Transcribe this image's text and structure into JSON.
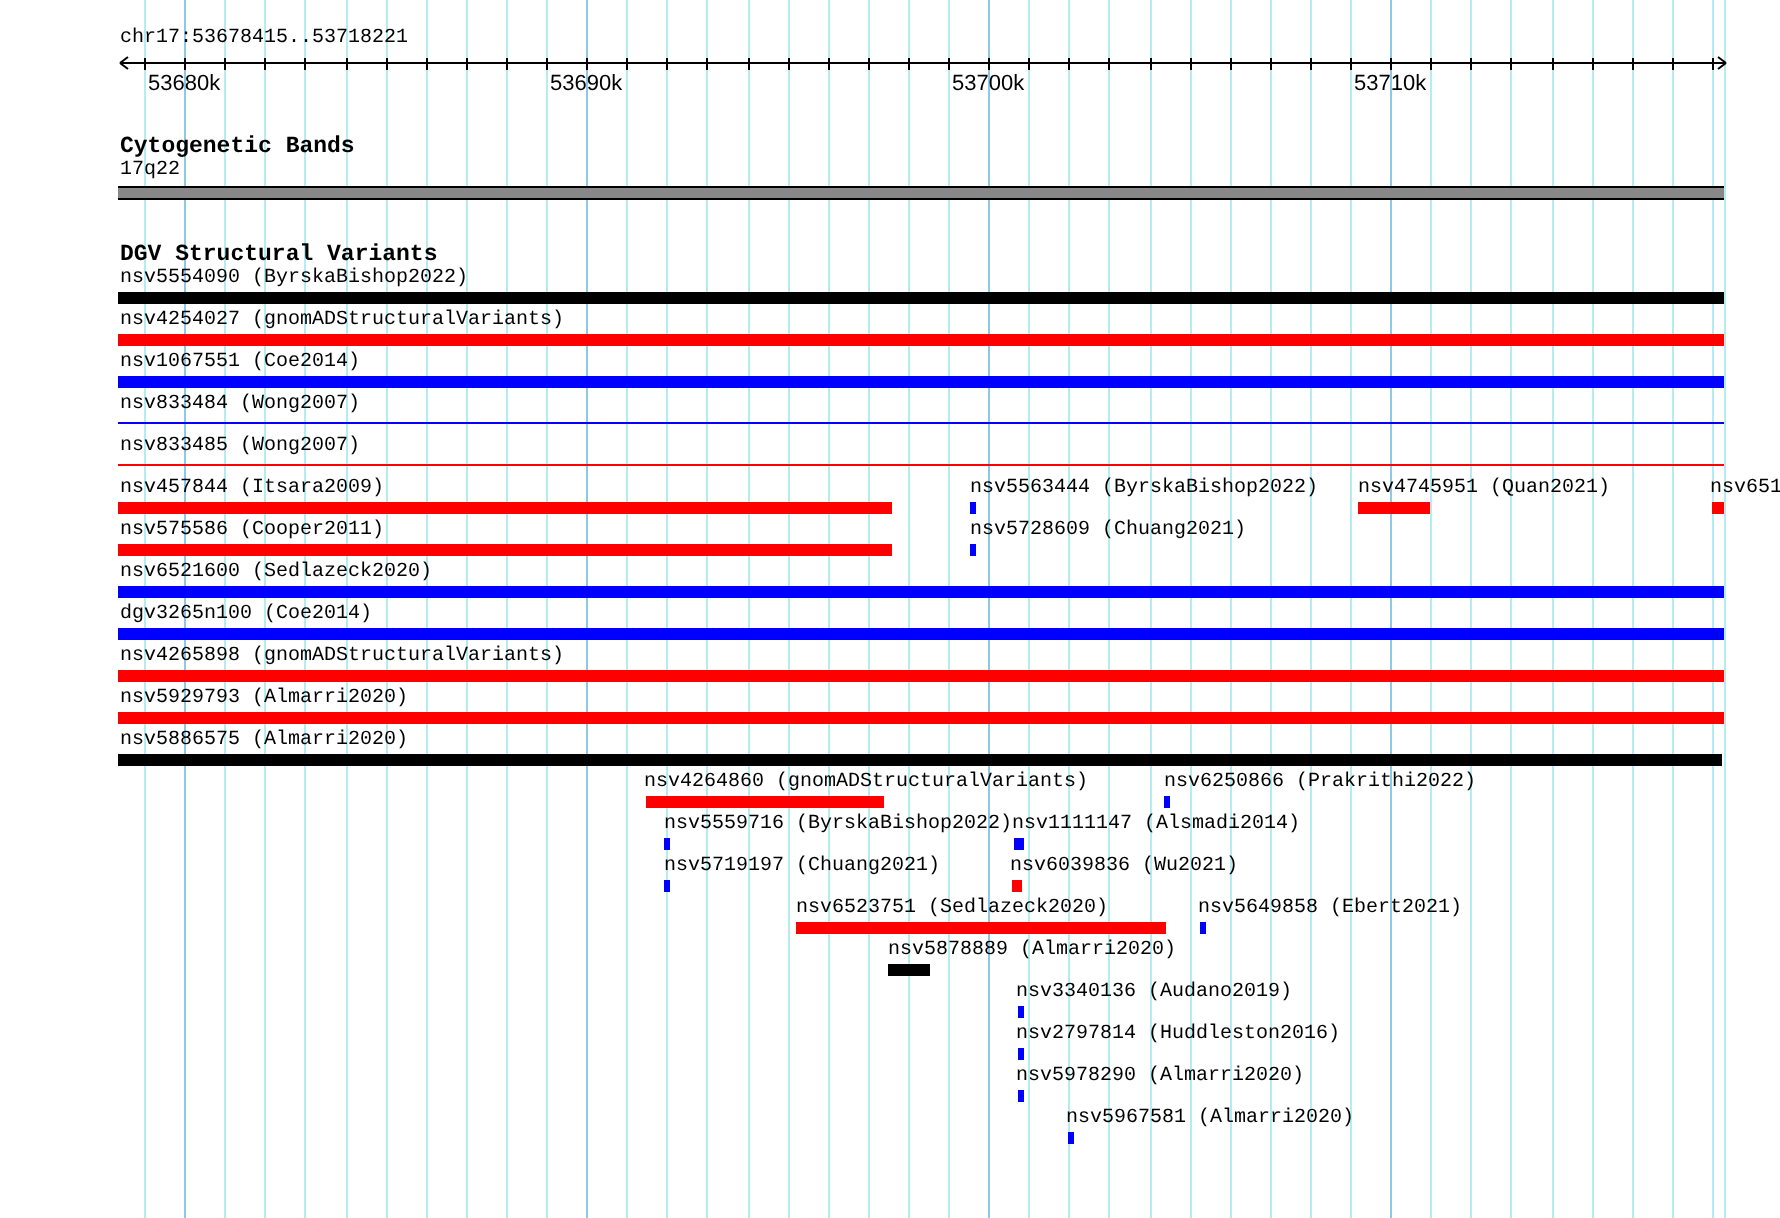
{
  "ruler": {
    "location": "chr17:53678415..53718221",
    "ticks": [
      "53680k",
      "53690k",
      "53700k",
      "53710k"
    ]
  },
  "tracks": [
    {
      "title": "Cytogenetic Bands",
      "features": [
        {
          "label": "17q22",
          "kind": "band",
          "color": "#888888"
        }
      ]
    },
    {
      "title": "DGV Structural Variants",
      "features": [
        {
          "label": "nsv5554090 (ByrskaBishop2022)",
          "kind": "bar",
          "color": "#000000"
        },
        {
          "label": "nsv4254027 (gnomADStructuralVariants)",
          "kind": "bar",
          "color": "#ff0000"
        },
        {
          "label": "nsv1067551 (Coe2014)",
          "kind": "bar",
          "color": "#0000ff"
        },
        {
          "label": "nsv833484 (Wong2007)",
          "kind": "line",
          "color": "#0000ff"
        },
        {
          "label": "nsv833485 (Wong2007)",
          "kind": "line",
          "color": "#ff0000"
        },
        {
          "label": "nsv457844 (Itsara2009)",
          "kind": "bar",
          "color": "#ff0000"
        },
        {
          "label": "nsv5563444 (ByrskaBishop2022)",
          "kind": "bar",
          "color": "#0000ff"
        },
        {
          "label": "nsv4745951 (Quan2021)",
          "kind": "bar",
          "color": "#ff0000"
        },
        {
          "label": "nsv651",
          "kind": "bar",
          "color": "#ff0000"
        },
        {
          "label": "nsv575586 (Cooper2011)",
          "kind": "bar",
          "color": "#ff0000"
        },
        {
          "label": "nsv5728609 (Chuang2021)",
          "kind": "bar",
          "color": "#0000ff"
        },
        {
          "label": "nsv6521600 (Sedlazeck2020)",
          "kind": "bar",
          "color": "#0000ff"
        },
        {
          "label": "dgv3265n100 (Coe2014)",
          "kind": "bar",
          "color": "#0000ff"
        },
        {
          "label": "nsv4265898 (gnomADStructuralVariants)",
          "kind": "bar",
          "color": "#ff0000"
        },
        {
          "label": "nsv5929793 (Almarri2020)",
          "kind": "bar",
          "color": "#ff0000"
        },
        {
          "label": "nsv5886575 (Almarri2020)",
          "kind": "bar",
          "color": "#000000"
        },
        {
          "label": "nsv4264860 (gnomADStructuralVariants)",
          "kind": "bar",
          "color": "#ff0000"
        },
        {
          "label": "nsv6250866 (Prakrithi2022)",
          "kind": "bar",
          "color": "#0000ff"
        },
        {
          "label": "nsv5559716 (ByrskaBishop2022)",
          "kind": "bar",
          "color": "#0000ff"
        },
        {
          "label": "nsv1111147 (Alsmadi2014)",
          "kind": "bar",
          "color": "#0000ff"
        },
        {
          "label": "nsv5719197 (Chuang2021)",
          "kind": "bar",
          "color": "#0000ff"
        },
        {
          "label": "nsv6039836 (Wu2021)",
          "kind": "bar",
          "color": "#ff0000"
        },
        {
          "label": "nsv6523751 (Sedlazeck2020)",
          "kind": "bar",
          "color": "#ff0000"
        },
        {
          "label": "nsv5649858 (Ebert2021)",
          "kind": "bar",
          "color": "#0000ff"
        },
        {
          "label": "nsv5878889 (Almarri2020)",
          "kind": "bar",
          "color": "#000000"
        },
        {
          "label": "nsv3340136 (Audano2019)",
          "kind": "bar",
          "color": "#0000ff"
        },
        {
          "label": "nsv2797814 (Huddleston2016)",
          "kind": "bar",
          "color": "#0000ff"
        },
        {
          "label": "nsv5978290 (Almarri2020)",
          "kind": "bar",
          "color": "#0000ff"
        },
        {
          "label": "nsv5967581 (Almarri2020)",
          "kind": "bar",
          "color": "#0000ff"
        }
      ]
    }
  ]
}
